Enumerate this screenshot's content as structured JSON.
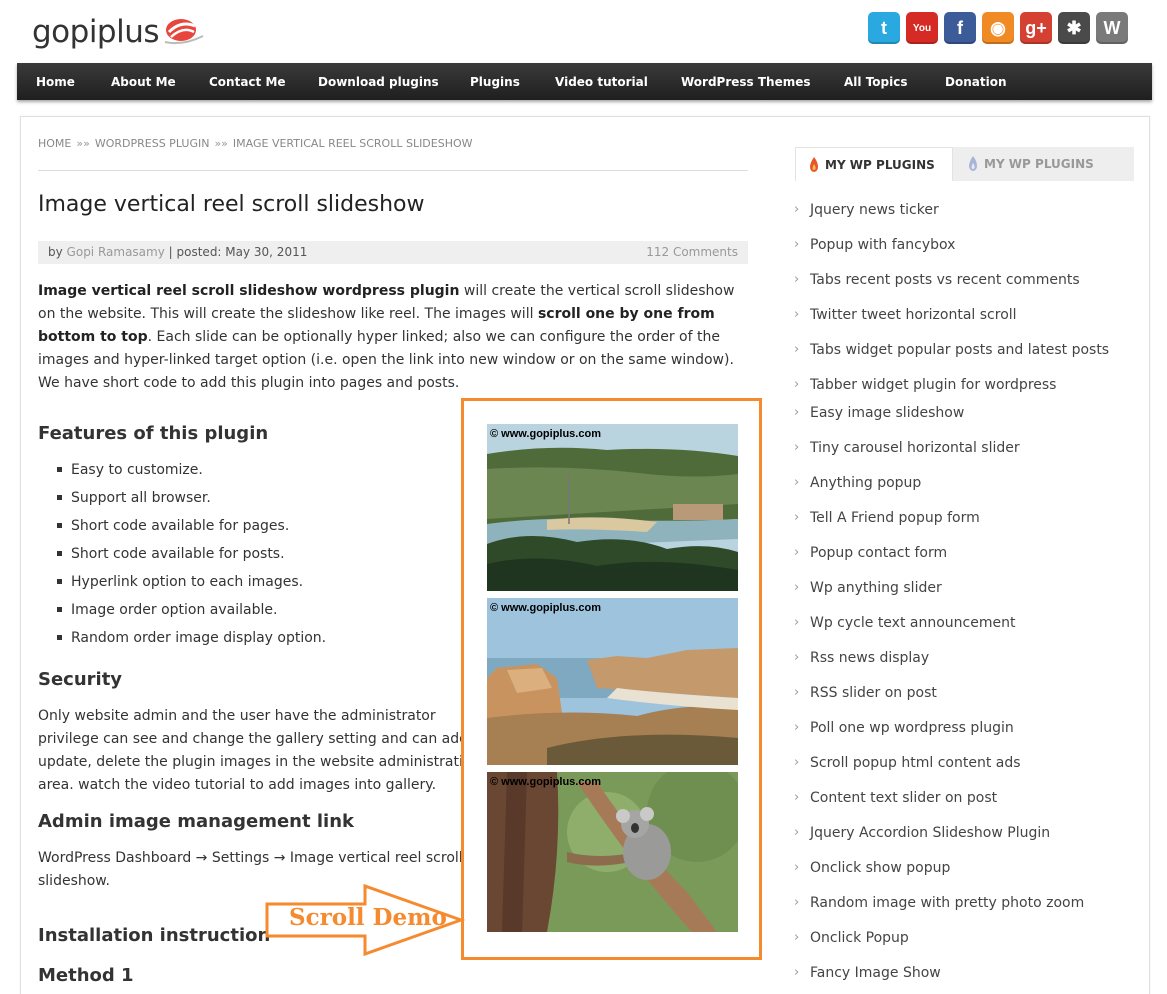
{
  "header": {
    "logo_text": "gopiplus",
    "social": [
      {
        "name": "twitter",
        "glyph": "t",
        "color": "#2aa9e0"
      },
      {
        "name": "youtube",
        "glyph": "You",
        "color": "#d62b24"
      },
      {
        "name": "facebook",
        "glyph": "f",
        "color": "#3b5b99"
      },
      {
        "name": "rss",
        "glyph": "◉",
        "color": "#f08a24"
      },
      {
        "name": "google-plus",
        "glyph": "g+",
        "color": "#d44132"
      },
      {
        "name": "joomla",
        "glyph": "✱",
        "color": "#4a4a4a"
      },
      {
        "name": "wordpress",
        "glyph": "W",
        "color": "#7a7a7a"
      }
    ]
  },
  "nav": {
    "items": [
      "Home",
      "About Me",
      "Contact Me",
      "Download plugins",
      "Plugins",
      "Video tutorial",
      "WordPress Themes",
      "All Topics",
      "Donation"
    ]
  },
  "breadcrumb": {
    "items": [
      "HOME",
      "WORDPRESS PLUGIN",
      "IMAGE VERTICAL REEL SCROLL SLIDESHOW"
    ],
    "separator": "»»"
  },
  "post": {
    "title": "Image vertical reel scroll slideshow",
    "meta_by": "by",
    "author": "Gopi Ramasamy",
    "posted": "| posted: May 30, 2011",
    "comments": "112 Comments",
    "intro": {
      "bold1": "Image vertical reel scroll slideshow wordpress plugin",
      "text1": " will create the vertical scroll slideshow on the website. This will create the slideshow like reel. The images will ",
      "bold2": "scroll one by one from bottom to top",
      "text2": ". Each slide can be optionally hyper linked; also we can configure the order of the images and hyper-linked target option (i.e. open the link into new window or on the same window). We have short code to add this plugin into pages and posts."
    },
    "features_heading": "Features of this plugin",
    "features": [
      "Easy to customize.",
      "Support all browser.",
      "Short code available for pages.",
      "Short code available for posts.",
      "Hyperlink option to each images.",
      "Image order option available.",
      "Random order image display option."
    ],
    "security_heading": "Security",
    "security_lines": [
      "Only website admin and the user have the administrator",
      "privilege can see and change the gallery setting and can add,",
      "update, delete the plugin images in the website administration",
      "area. watch the video tutorial to add images into gallery."
    ],
    "admin_heading": "Admin image management link",
    "admin_lines": [
      "WordPress Dashboard → Settings → Image vertical reel scroll",
      "slideshow."
    ],
    "install_heading": "Installation instruction",
    "method_heading": "Method 1"
  },
  "demo": {
    "watermark": "© www.gopiplus.com",
    "arrow_label": "Scroll Demo"
  },
  "sidebar": {
    "tab_active": "MY WP PLUGINS",
    "tab_inactive": "MY WP PLUGINS",
    "items": [
      "Jquery news ticker",
      "Popup with fancybox",
      "Tabs recent posts vs recent comments",
      "Twitter tweet horizontal scroll",
      "Tabs widget popular posts and latest posts",
      "Tabber widget plugin for wordpress",
      "Easy image slideshow",
      "Tiny carousel horizontal slider",
      "Anything popup",
      "Tell A Friend popup form",
      "Popup contact form",
      "Wp anything slider",
      "Wp cycle text announcement",
      "Rss news display",
      "RSS slider on post",
      "Poll one wp wordpress plugin",
      "Scroll popup html content ads",
      "Content text slider on post",
      "Jquery Accordion Slideshow Plugin",
      "Onclick show popup",
      "Random image with pretty photo zoom",
      "Onclick Popup",
      "Fancy Image Show"
    ]
  },
  "colors": {
    "accent_orange": "#f58a2e",
    "nav_bg": "#2b2b2b"
  }
}
